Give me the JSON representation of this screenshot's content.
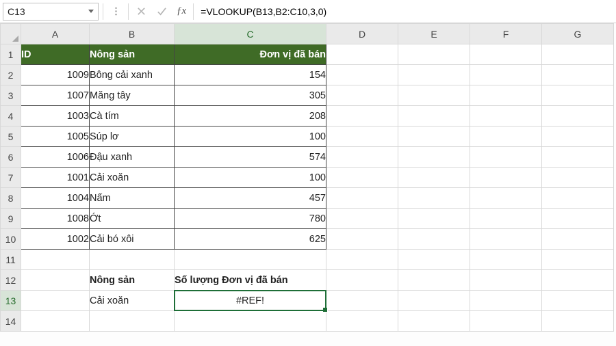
{
  "name_box": {
    "value": "C13"
  },
  "formula": "=VLOOKUP(B13,B2:C10,3,0)",
  "columns": [
    "A",
    "B",
    "C",
    "D",
    "E",
    "F",
    "G"
  ],
  "row_count": 14,
  "headers": {
    "A": "ID",
    "B": "Nông sản",
    "C": "Đơn vị đã bán"
  },
  "table_rows": [
    {
      "id": "1009",
      "name": "Bông cải xanh",
      "units": "154"
    },
    {
      "id": "1007",
      "name": "Măng tây",
      "units": "305"
    },
    {
      "id": "1003",
      "name": "Cà tím",
      "units": "208"
    },
    {
      "id": "1005",
      "name": "Súp lơ",
      "units": "100"
    },
    {
      "id": "1006",
      "name": "Đậu xanh",
      "units": "574"
    },
    {
      "id": "1001",
      "name": "Cải xoăn",
      "units": "100"
    },
    {
      "id": "1004",
      "name": "Nấm",
      "units": "457"
    },
    {
      "id": "1008",
      "name": "Ớt",
      "units": "780"
    },
    {
      "id": "1002",
      "name": "Cải bó xôi",
      "units": "625"
    }
  ],
  "lookup": {
    "label_b": "Nông sản",
    "label_c": "Số lượng Đơn vị đã bán",
    "value_b": "Cải xoăn",
    "result_c": "#REF!"
  },
  "active_cell": {
    "row": 13,
    "col": "C"
  }
}
